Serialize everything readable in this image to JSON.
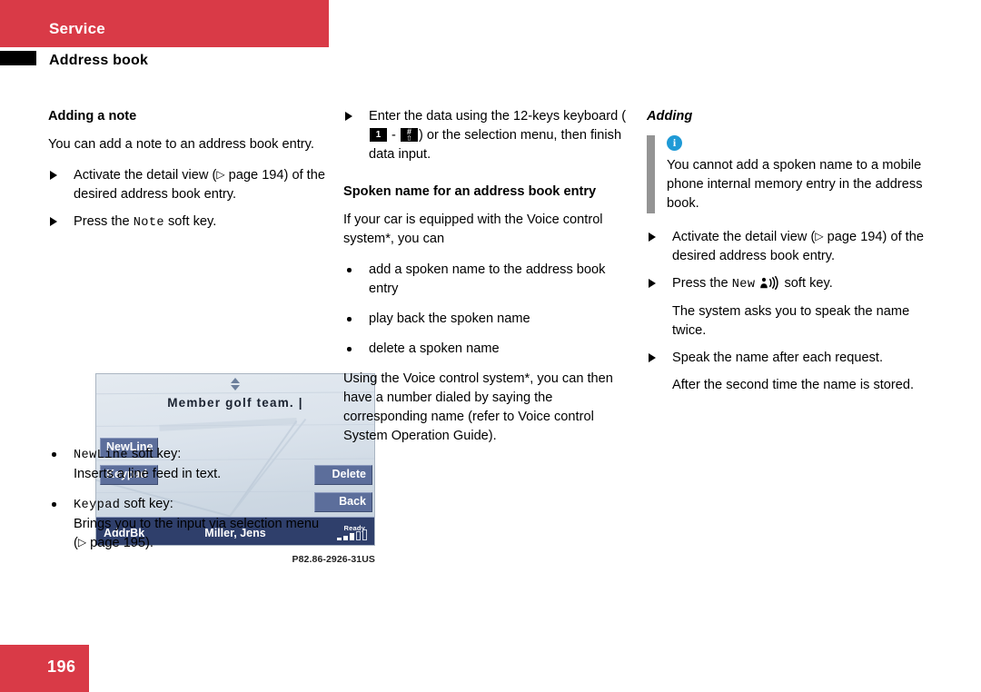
{
  "header": {
    "band_label": "Service",
    "subtitle": "Address book"
  },
  "footer": {
    "page_number": "196"
  },
  "left_column": {
    "heading": "Adding a note",
    "intro": "You can add a note to an address book entry.",
    "step1_a": "Activate the detail view (",
    "step1_pgref": "page 194",
    "step1_b": ") of the desired address book entry.",
    "step2_a": "Press the ",
    "step2_key": "Note",
    "step2_b": " soft key.",
    "bullet1_key": "NewLine",
    "bullet1_label": " soft key:",
    "bullet1_desc": "Inserts a line feed in text.",
    "bullet2_key": "Keypad",
    "bullet2_label": " soft key:",
    "bullet2_desc_a": "Brings you to the input via selection menu (",
    "bullet2_pgref": "page 195",
    "bullet2_desc_b": ")."
  },
  "figure": {
    "note_text": "Member golf team. |",
    "softkeys": {
      "newline": "NewLine",
      "keypad": "Keypad",
      "delete": "Delete",
      "back": "Back"
    },
    "status": {
      "left": "AddrBk",
      "center": "Miller, Jens",
      "ready": "Ready"
    },
    "caption": "P82.86-2926-31US"
  },
  "middle_column": {
    "step1_a": "Enter the data using the 12-keys keyboard (",
    "step1_key1": "1",
    "step1_dash": " - ",
    "step1_key2_top": "#",
    "step1_key2_bottom": "⇧",
    "step1_b": ") or the selection menu, then finish data input.",
    "heading": "Spoken name for an address book entry",
    "intro": "If your car is equipped with the Voice control system*, you can",
    "bullets": [
      "add a spoken name to the address book entry",
      "play back the spoken name",
      "delete a spoken name"
    ],
    "closing": "Using the Voice control system*, you can then have a number dialed by saying the corresponding name (refer to Voice control System Operation Guide)."
  },
  "right_column": {
    "heading": "Adding",
    "note_text": "You cannot add a spoken name to a mobile phone internal memory entry in the address book.",
    "step1_a": "Activate the detail view (",
    "step1_pgref": "page 194",
    "step1_b": ") of the desired address book entry.",
    "step2_a": "Press the ",
    "step2_key": "New",
    "step2_b": " soft key.",
    "cont1": "The system asks you to speak the name twice.",
    "step3": "Speak the name after each request.",
    "cont2": "After the second time the name is stored."
  },
  "colors": {
    "brand_red": "#d93a47",
    "info_blue": "#1f9ad6",
    "note_bar_gray": "#949494",
    "screen_status_navy": "#2f3f6b",
    "softkey_blue": "#5c6e9b"
  }
}
